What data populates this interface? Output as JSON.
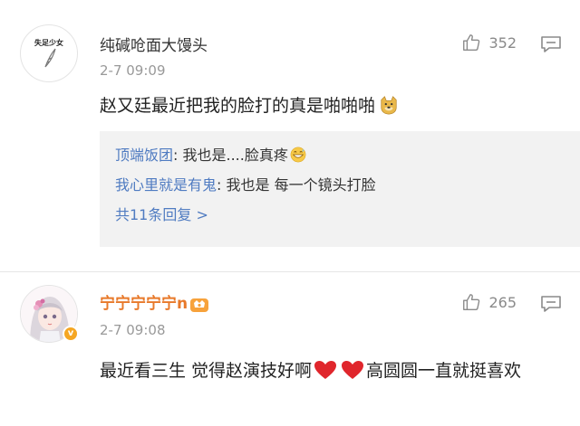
{
  "comments": [
    {
      "avatar_text": "失足少女",
      "username": "纯碱呛面大馒头",
      "time": "2-7 09:09",
      "likes": "352",
      "content": "赵又廷最近把我的脸打的真是啪啪啪",
      "content_emoji": "doge-emoji",
      "replies": [
        {
          "author": "顶端饭团",
          "sep": ": ",
          "text": "我也是....脸真疼",
          "emoji": "grinning-sweat-emoji"
        },
        {
          "author": "我心里就是有鬼",
          "sep": ": ",
          "text": "我也是  每一个镜头打脸"
        }
      ],
      "more_replies": "共11条回复 >"
    },
    {
      "username": "宁宁宁宁宁n",
      "username_badge": "vip-crown-icon",
      "verified_badge": "v",
      "time": "2-7 09:08",
      "likes": "265",
      "content_part1": "最近看三生 觉得赵演技好啊",
      "content_part2": "高圆圆一直就挺喜欢",
      "content_emoji": "red-heart-emoji"
    }
  ],
  "colors": {
    "link_blue": "#4f7bc1",
    "vip_orange": "#e8792a",
    "meta_gray": "#999999",
    "reply_bg": "#f2f2f2",
    "heart_red": "#e0262c"
  }
}
